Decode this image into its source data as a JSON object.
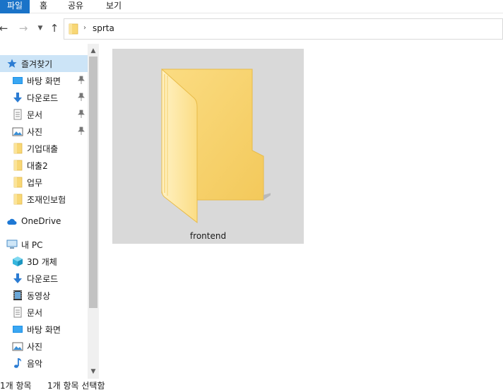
{
  "ribbon": {
    "tabs": [
      "파일",
      "홈",
      "공유",
      "보기"
    ]
  },
  "address": {
    "path": "sprta",
    "folder_icon": "folder-icon"
  },
  "nav": {
    "quick_access": "즐겨찾기",
    "quick_items": [
      {
        "label": "바탕 화면",
        "icon": "desktop-icon",
        "pinned": true
      },
      {
        "label": "다운로드",
        "icon": "download-icon",
        "pinned": true
      },
      {
        "label": "문서",
        "icon": "document-icon",
        "pinned": true
      },
      {
        "label": "사진",
        "icon": "pictures-icon",
        "pinned": true
      },
      {
        "label": "기업대출",
        "icon": "folder-icon",
        "pinned": false
      },
      {
        "label": "대출2",
        "icon": "folder-icon",
        "pinned": false
      },
      {
        "label": "업무",
        "icon": "folder-icon",
        "pinned": false
      },
      {
        "label": "조재인보험",
        "icon": "folder-icon",
        "pinned": false
      }
    ],
    "onedrive": "OneDrive",
    "this_pc": "내 PC",
    "pc_items": [
      {
        "label": "3D 개체",
        "icon": "3d-objects-icon"
      },
      {
        "label": "다운로드",
        "icon": "download-icon"
      },
      {
        "label": "동영상",
        "icon": "video-icon"
      },
      {
        "label": "문서",
        "icon": "document-icon"
      },
      {
        "label": "바탕 화면",
        "icon": "desktop-icon"
      },
      {
        "label": "사진",
        "icon": "pictures-icon"
      },
      {
        "label": "음악",
        "icon": "music-icon"
      }
    ]
  },
  "content": {
    "items": [
      {
        "name": "frontend",
        "type": "folder",
        "selected": true
      }
    ]
  },
  "status": {
    "item_count": "1개 항목",
    "selected_count": "1개 항목 선택함"
  },
  "colors": {
    "accent": "#1a73c8",
    "selection": "#cce4f7",
    "tile_selected": "#d9d9d9",
    "folder": "#f8d775"
  }
}
